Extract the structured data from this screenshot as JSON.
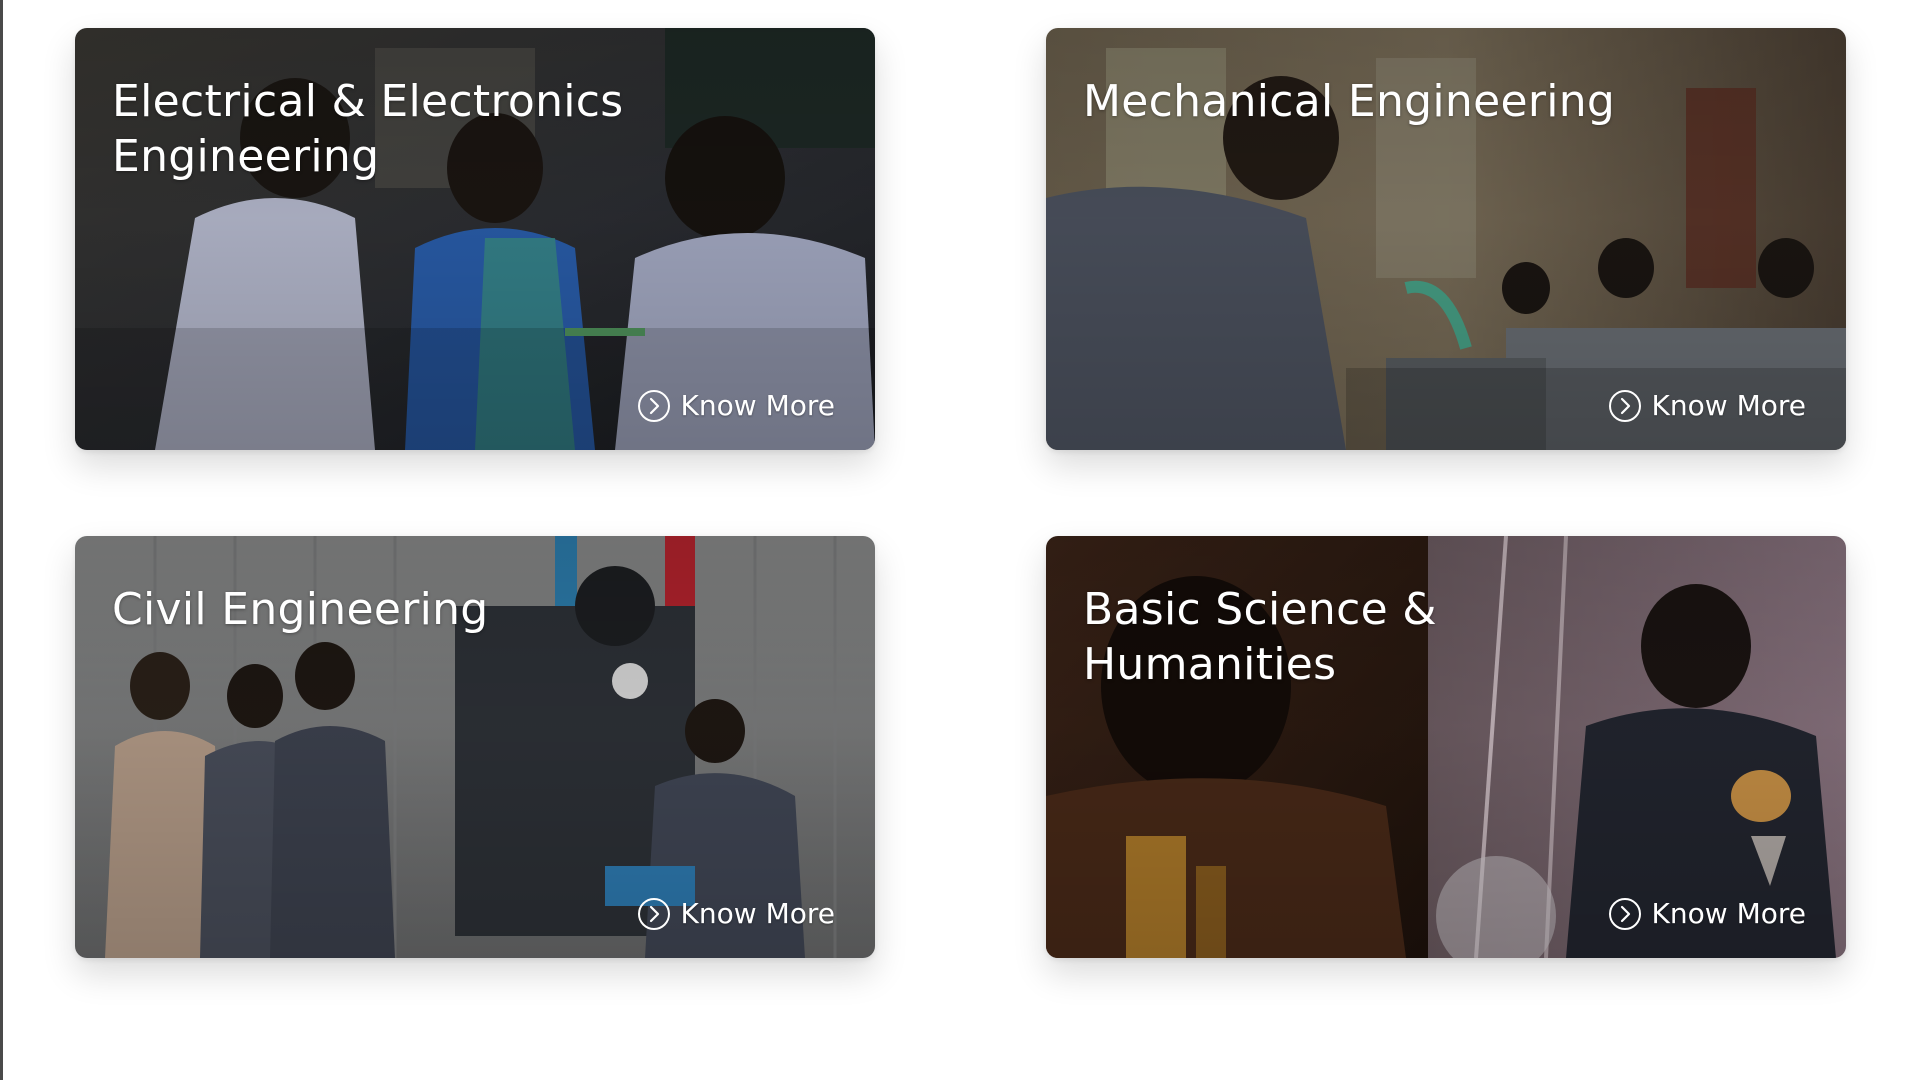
{
  "cards": [
    {
      "title": "Electrical & Electronics Engineering",
      "link_label": "Know More",
      "link_icon": "chevron-circle-right-icon",
      "photo_subject": "students-with-instructor-in-electronics-lab"
    },
    {
      "title": "Mechanical Engineering",
      "link_label": "Know More",
      "link_icon": "chevron-circle-right-icon",
      "photo_subject": "student-operating-lathe-in-workshop"
    },
    {
      "title": "Civil Engineering",
      "link_label": "Know More",
      "link_icon": "chevron-circle-right-icon",
      "photo_subject": "students-at-pump-test-rig"
    },
    {
      "title": "Basic Science & Humanities",
      "link_label": "Know More",
      "link_icon": "chevron-circle-right-icon",
      "photo_subject": "students-in-science-lab"
    }
  ],
  "colors": {
    "page_background": "#ffffff",
    "text": "#ffffff",
    "left_edge": "#4a4a4a"
  }
}
